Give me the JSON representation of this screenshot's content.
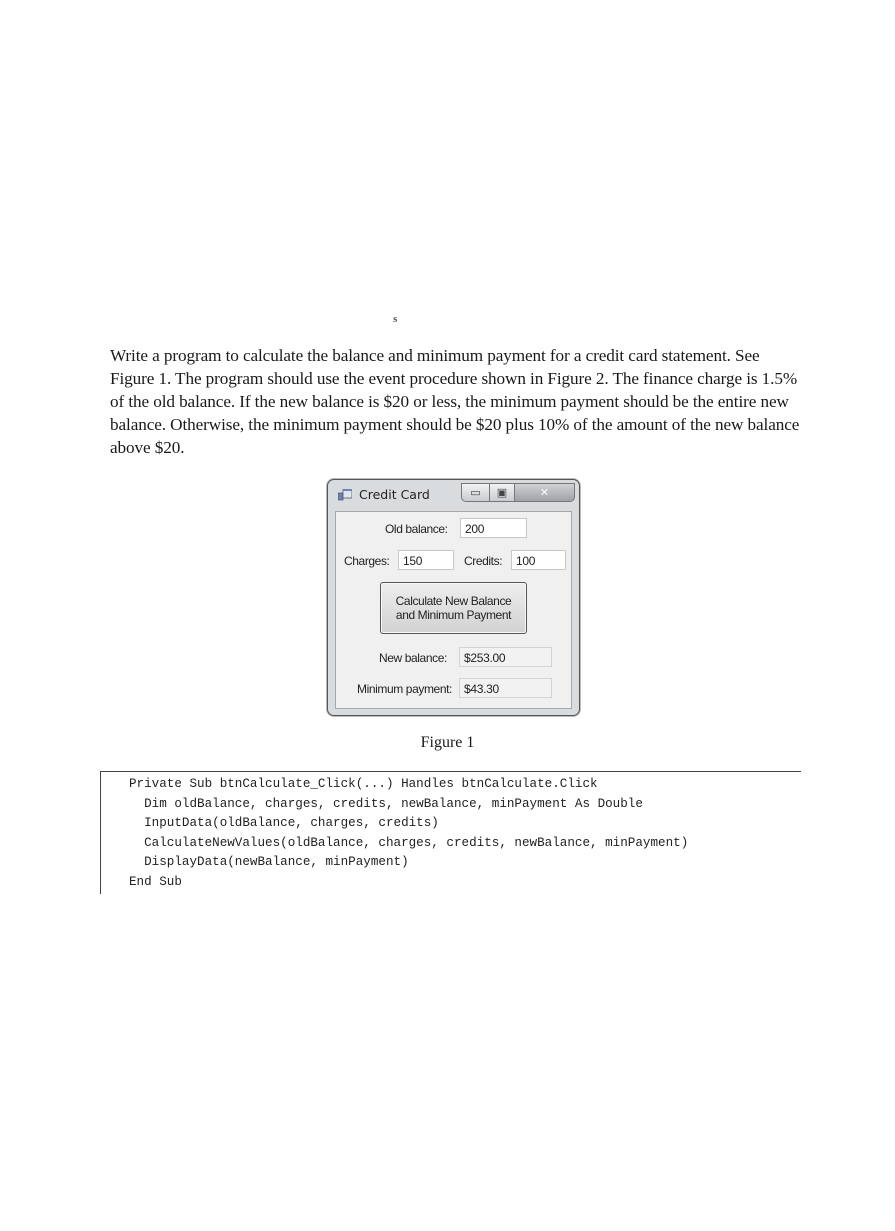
{
  "page_mark": "s",
  "problem_text": "Write a program to calculate the balance and minimum payment for a credit card statement. See Figure 1. The program should use the event procedure shown in Figure 2. The finance charge is 1.5% of the old balance. If the new balance is $20 or less, the minimum payment should be the entire new balance. Otherwise, the minimum payment should be $20 plus 10% of the amount of the new balance above $20.",
  "window": {
    "title": "Credit Card",
    "icon": "app-form-icon",
    "controls": {
      "minimize": "minimize-icon",
      "maximize": "maximize-icon",
      "close": "close-icon"
    },
    "old_balance_label": "Old balance:",
    "old_balance_value": "200",
    "charges_label": "Charges:",
    "charges_value": "150",
    "credits_label": "Credits:",
    "credits_value": "100",
    "calculate_button_line1": "Calculate New Balance",
    "calculate_button_line2": "and Minimum Payment",
    "new_balance_label": "New balance:",
    "new_balance_value": "$253.00",
    "min_payment_label": "Minimum payment:",
    "min_payment_value": "$43.30"
  },
  "figure1_caption": "Figure 1",
  "code_lines": [
    "Private Sub btnCalculate_Click(...) Handles btnCalculate.Click",
    "  Dim oldBalance, charges, credits, newBalance, minPayment As Double",
    "  InputData(oldBalance, charges, credits)",
    "  CalculateNewValues(oldBalance, charges, credits, newBalance, minPayment)",
    "  DisplayData(newBalance, minPayment)",
    "End Sub"
  ]
}
